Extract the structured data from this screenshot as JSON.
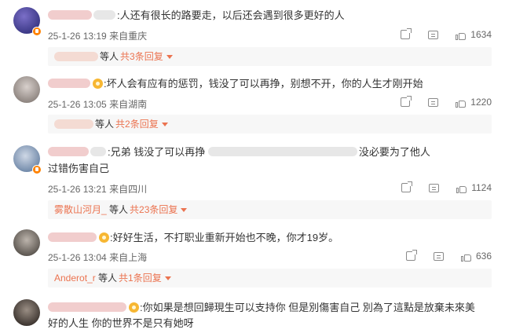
{
  "comments": [
    {
      "content": ":人还有很长的路要走，以后还会遇到很多更好的人",
      "time": "25-1-26 13:19",
      "location": "来自重庆",
      "likes": "1634",
      "sub_more": "共3条回复",
      "sub_deng": "等人"
    },
    {
      "content": ":坏人会有应有的惩罚，钱没了可以再挣，别想不开，你的人生才刚开始",
      "time": "25-1-26 13:05",
      "location": "来自湖南",
      "likes": "1220",
      "sub_more": "共2条回复",
      "sub_deng": "等人"
    },
    {
      "content": ":兄弟 钱没了可以再挣 ",
      "content_tail": "没必要为了他人",
      "content2": "过错伤害自己",
      "time": "25-1-26 13:21",
      "location": "来自四川",
      "likes": "1124",
      "sub_name": "雾散山河月_",
      "sub_deng": " 等人",
      "sub_more": "共23条回复"
    },
    {
      "content": ":好好生活，不打职业重新开始也不晚，你才19岁。",
      "time": "25-1-26 13:04",
      "location": "来自上海",
      "likes": "636",
      "sub_name": "Anderot_r",
      "sub_deng": " 等人",
      "sub_more": "共1条回复"
    },
    {
      "content": ":你如果是想回歸現生可以支持你 但是別傷害自己 別為了這點是放棄未來美",
      "content2": "好的人生 你的世界不是只有她呀"
    }
  ],
  "colors": {
    "accent": "#eb7350",
    "text": "#333333",
    "meta": "#666666",
    "sub_bg": "#f7f7f7",
    "vip_badge": "#ff8200"
  },
  "icons": [
    "share-icon",
    "comment-icon",
    "like-icon",
    "caret-down-icon",
    "verified-badge-icon",
    "emoji-icon"
  ]
}
